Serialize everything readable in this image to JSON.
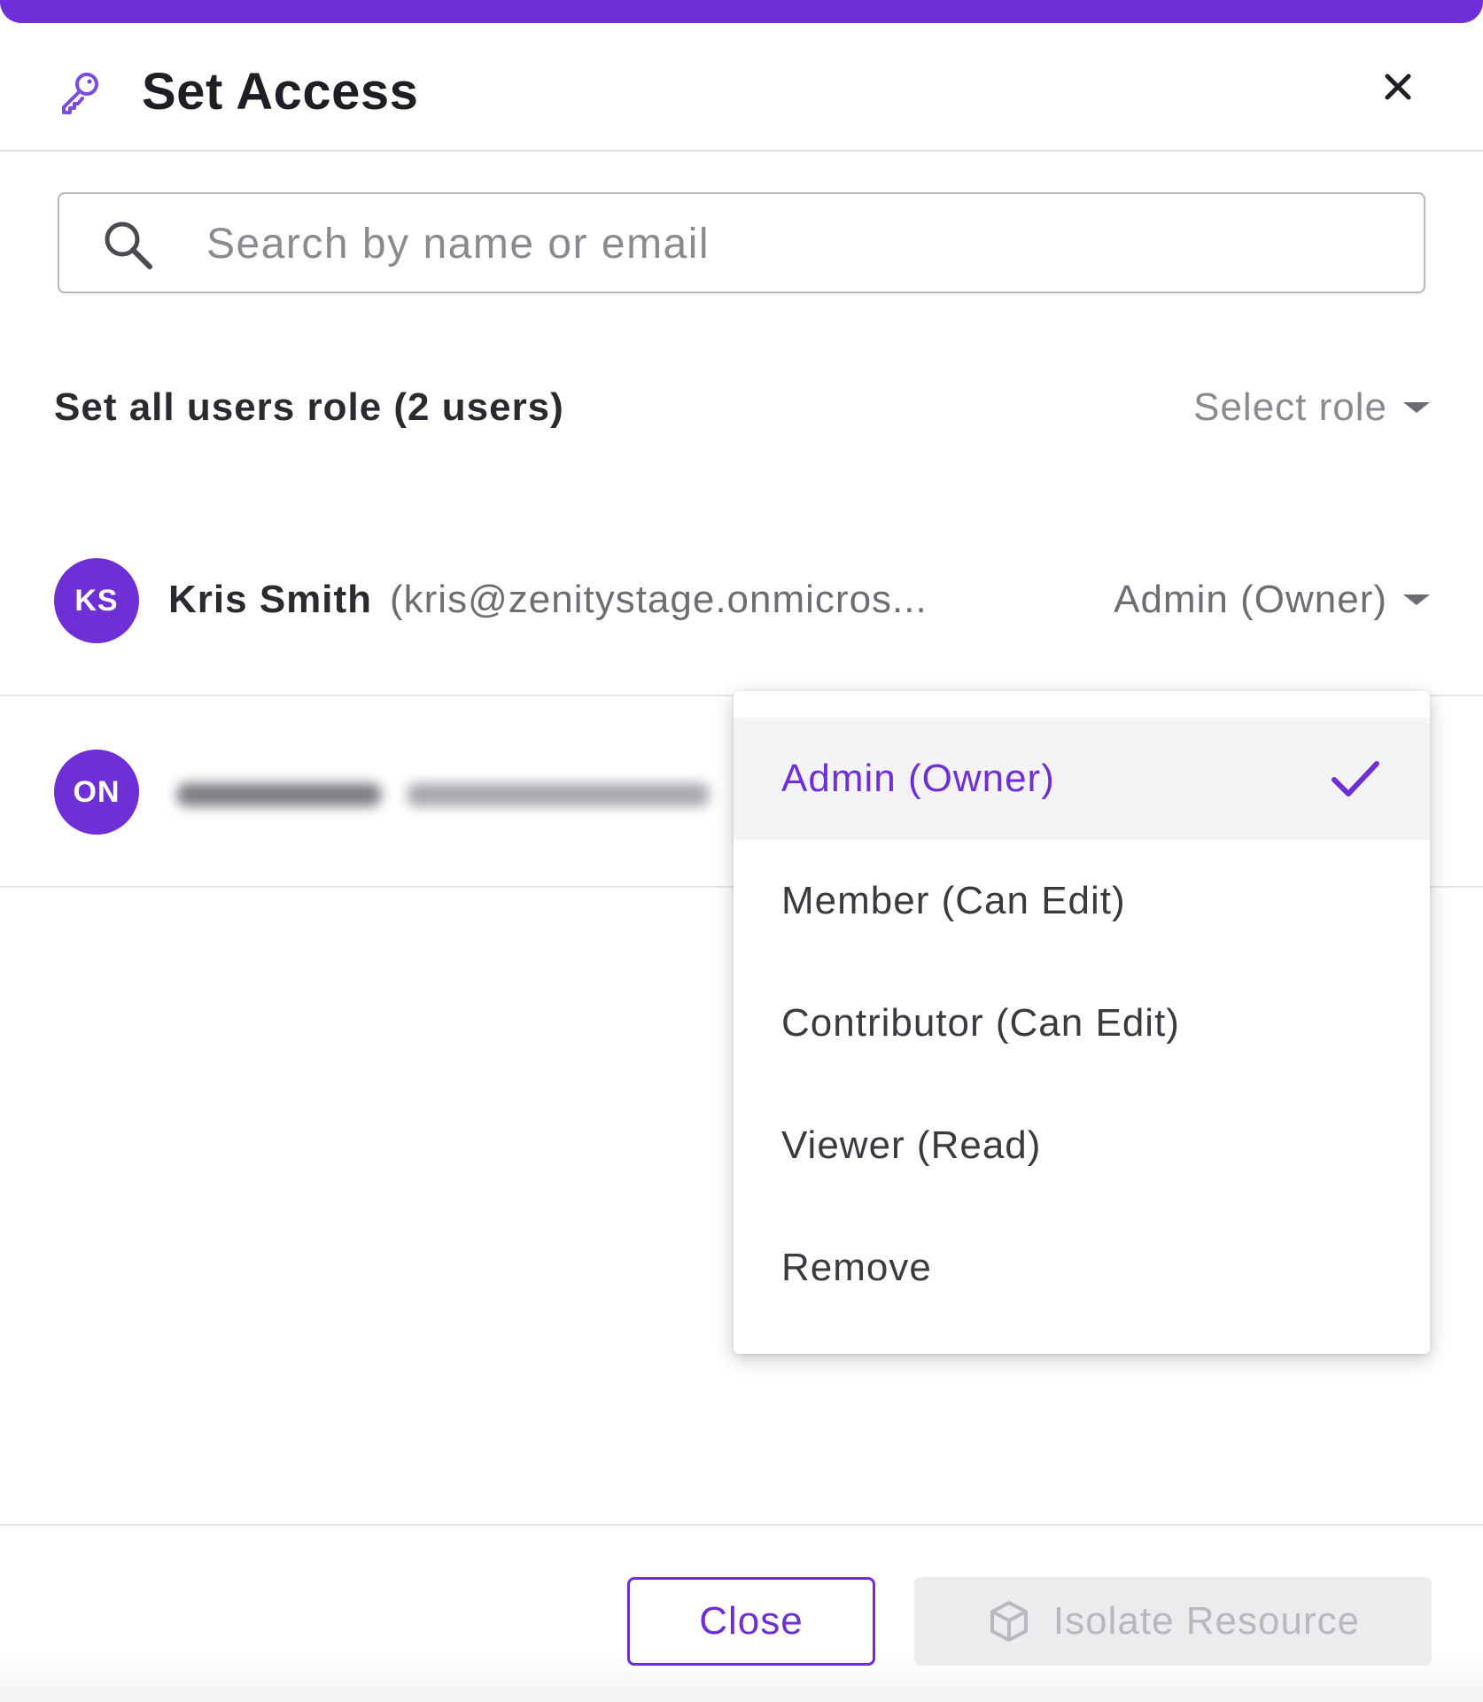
{
  "dialog": {
    "title": "Set Access",
    "accent_color": "#6e2fd6"
  },
  "search": {
    "placeholder": "Search by name or email",
    "value": ""
  },
  "bulk_role": {
    "label": "Set all users role (2 users)",
    "select_placeholder": "Select role"
  },
  "users": [
    {
      "initials": "KS",
      "name": "Kris Smith",
      "email": "(kris@zenitystage.onmicros...",
      "role": "Admin (Owner)"
    },
    {
      "initials": "ON"
    }
  ],
  "role_menu": {
    "options": [
      {
        "label": "Admin (Owner)",
        "selected": true
      },
      {
        "label": "Member (Can Edit)",
        "selected": false
      },
      {
        "label": "Contributor (Can Edit)",
        "selected": false
      },
      {
        "label": "Viewer (Read)",
        "selected": false
      },
      {
        "label": "Remove",
        "selected": false
      }
    ]
  },
  "footer": {
    "close_label": "Close",
    "isolate_label": "Isolate Resource"
  },
  "icons": {
    "header": "key-icon",
    "close": "close-icon",
    "search": "search-icon",
    "selected": "check-icon",
    "isolate": "cube-icon"
  }
}
